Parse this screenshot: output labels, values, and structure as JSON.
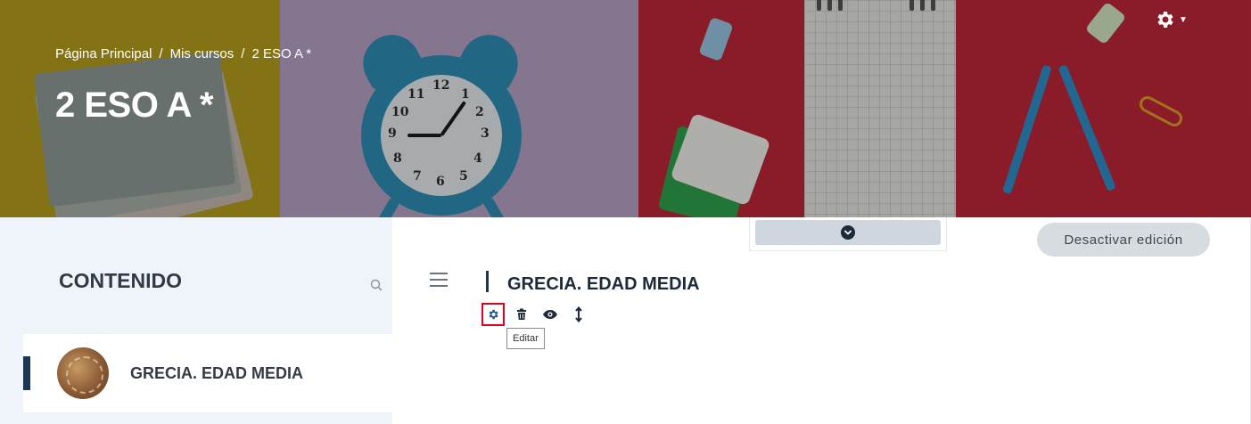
{
  "banner": {
    "breadcrumb": {
      "home": "Página Principal",
      "my_courses": "Mis cursos",
      "current": "2 ESO A *",
      "separator": "/"
    },
    "course_title": "2 ESO A *",
    "settings_icon": "gear-icon"
  },
  "sidebar": {
    "header": "CONTENIDO",
    "search_icon": "search-icon",
    "items": [
      {
        "label": "GRECIA. EDAD MEDIA",
        "active": true
      }
    ]
  },
  "main": {
    "collapse_icon": "chevron-down-circle-icon",
    "edit_toggle_label": "Desactivar edición",
    "section": {
      "title": "GRECIA. EDAD MEDIA",
      "actions": [
        {
          "icon": "gear-icon",
          "name": "edit"
        },
        {
          "icon": "trash-icon",
          "name": "delete"
        },
        {
          "icon": "eye-icon",
          "name": "hide"
        },
        {
          "icon": "move-icon",
          "name": "move"
        }
      ],
      "tooltip": "Editar"
    }
  },
  "colors": {
    "accent_navy": "#1c3656",
    "highlight_red": "#e0001b",
    "sidebar_bg": "#eff4fb"
  }
}
